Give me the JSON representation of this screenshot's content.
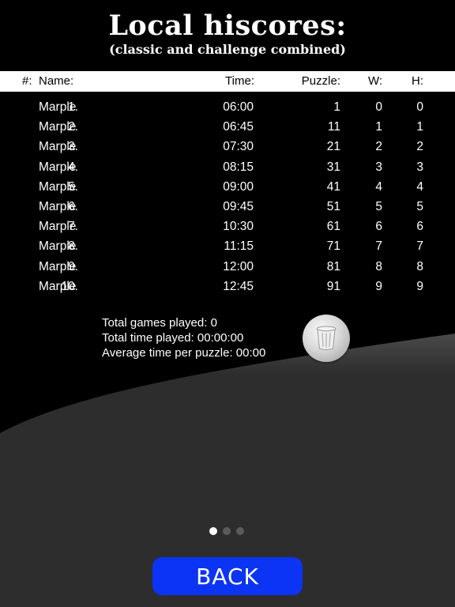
{
  "title": "Local hiscores:",
  "subtitle": "(classic and challenge combined)",
  "columns": {
    "rank": "#:",
    "name": "Name:",
    "time": "Time:",
    "puzzle": "Puzzle:",
    "w": "W:",
    "h": "H:"
  },
  "rows": [
    {
      "rank": "1.",
      "name": "Marple",
      "time": "06:00",
      "puzzle": "1",
      "w": "0",
      "h": "0"
    },
    {
      "rank": "2.",
      "name": "Marple",
      "time": "06:45",
      "puzzle": "11",
      "w": "1",
      "h": "1"
    },
    {
      "rank": "3.",
      "name": "Marple",
      "time": "07:30",
      "puzzle": "21",
      "w": "2",
      "h": "2"
    },
    {
      "rank": "4.",
      "name": "Marple",
      "time": "08:15",
      "puzzle": "31",
      "w": "3",
      "h": "3"
    },
    {
      "rank": "5.",
      "name": "Marple",
      "time": "09:00",
      "puzzle": "41",
      "w": "4",
      "h": "4"
    },
    {
      "rank": "6.",
      "name": "Marple",
      "time": "09:45",
      "puzzle": "51",
      "w": "5",
      "h": "5"
    },
    {
      "rank": "7.",
      "name": "Marple",
      "time": "10:30",
      "puzzle": "61",
      "w": "6",
      "h": "6"
    },
    {
      "rank": "8.",
      "name": "Marple",
      "time": "11:15",
      "puzzle": "71",
      "w": "7",
      "h": "7"
    },
    {
      "rank": "9.",
      "name": "Marple",
      "time": "12:00",
      "puzzle": "81",
      "w": "8",
      "h": "8"
    },
    {
      "rank": "10.",
      "name": "Marple",
      "time": "12:45",
      "puzzle": "91",
      "w": "9",
      "h": "9"
    }
  ],
  "stats": {
    "total_games": "Total games played: 0",
    "total_time": "Total time played: 00:00:00",
    "average_time": "Average time per puzzle: 00:00"
  },
  "trash_icon": "trash-can-icon",
  "pager": {
    "count": 3,
    "active": 0
  },
  "back_label": "BACK",
  "colors": {
    "background": "#000000",
    "lower_area": "#2d2d2d",
    "back_button": "#0b34f5",
    "header_bar": "#ffffff"
  }
}
